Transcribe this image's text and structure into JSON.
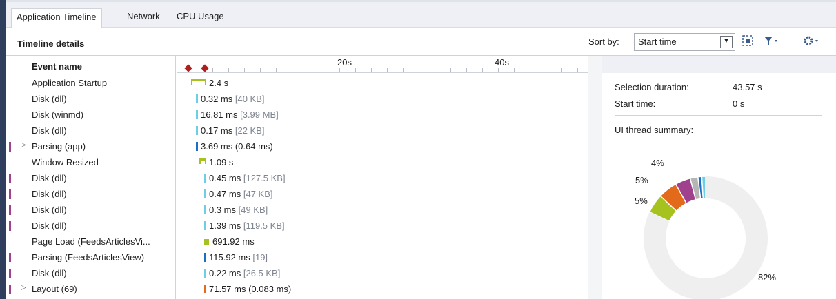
{
  "tabs": [
    {
      "label": "Application Timeline",
      "active": true
    },
    {
      "label": "Network",
      "active": false
    },
    {
      "label": "CPU Usage",
      "active": false
    }
  ],
  "header": {
    "title": "Timeline details",
    "sort_label": "Sort by:",
    "sort_value": "Start time",
    "icons": [
      "zoom-to-selection-icon",
      "filter-icon",
      "settings-icon"
    ]
  },
  "events": {
    "column_header": "Event name",
    "rows": [
      {
        "label": "Application Startup",
        "marker": false,
        "expandable": false
      },
      {
        "label": "Disk (dll)",
        "marker": false,
        "expandable": false
      },
      {
        "label": "Disk (winmd)",
        "marker": false,
        "expandable": false
      },
      {
        "label": "Disk (dll)",
        "marker": false,
        "expandable": false
      },
      {
        "label": "Parsing (app)",
        "marker": true,
        "expandable": true
      },
      {
        "label": "Window Resized",
        "marker": false,
        "expandable": false
      },
      {
        "label": "Disk (dll)",
        "marker": true,
        "expandable": false
      },
      {
        "label": "Disk (dll)",
        "marker": true,
        "expandable": false
      },
      {
        "label": "Disk (dll)",
        "marker": true,
        "expandable": false
      },
      {
        "label": "Disk (dll)",
        "marker": true,
        "expandable": false
      },
      {
        "label": "Page Load (FeedsArticlesVi...",
        "marker": false,
        "expandable": false
      },
      {
        "label": "Parsing (FeedsArticlesView)",
        "marker": true,
        "expandable": false
      },
      {
        "label": "Disk (dll)",
        "marker": true,
        "expandable": false
      },
      {
        "label": "Layout (69)",
        "marker": true,
        "expandable": true
      }
    ]
  },
  "timeline": {
    "ruler_labels": [
      "20s",
      "40s"
    ],
    "bars": [
      {
        "kind": "bracket",
        "color": "#a6c21e",
        "text": "2.4 s",
        "extra": ""
      },
      {
        "kind": "solid",
        "color": "#6fcde4",
        "text": "0.32 ms",
        "extra": "[40 KB]"
      },
      {
        "kind": "solid",
        "color": "#6fcde4",
        "text": "16.81 ms",
        "extra": "[3.99 MB]"
      },
      {
        "kind": "solid",
        "color": "#6fcde4",
        "text": "0.17 ms",
        "extra": "[22 KB]"
      },
      {
        "kind": "solid",
        "color": "#1a6fc3",
        "text": "3.69 ms (0.64 ms)",
        "extra": ""
      },
      {
        "kind": "bracket",
        "color": "#a6c21e",
        "text": "1.09 s",
        "extra": ""
      },
      {
        "kind": "solid",
        "color": "#6fcde4",
        "text": "0.45 ms",
        "extra": "[127.5 KB]"
      },
      {
        "kind": "solid",
        "color": "#6fcde4",
        "text": "0.47 ms",
        "extra": "[47 KB]"
      },
      {
        "kind": "solid",
        "color": "#6fcde4",
        "text": "0.3 ms",
        "extra": "[49 KB]"
      },
      {
        "kind": "solid",
        "color": "#6fcde4",
        "text": "1.39 ms",
        "extra": "[119.5 KB]"
      },
      {
        "kind": "square",
        "color": "#a6c21e",
        "text": "691.92 ms",
        "extra": ""
      },
      {
        "kind": "solid",
        "color": "#1a6fc3",
        "text": "115.92 ms",
        "extra": "[19]"
      },
      {
        "kind": "solid",
        "color": "#6fcde4",
        "text": "0.22 ms",
        "extra": "[26.5 KB]"
      },
      {
        "kind": "solid",
        "color": "#e36a1a",
        "text": "71.57 ms (0.083 ms)",
        "extra": ""
      }
    ]
  },
  "summary": {
    "selection_duration_label": "Selection duration:",
    "selection_duration_value": "43.57 s",
    "start_time_label": "Start time:",
    "start_time_value": "0 s",
    "ui_thread_label": "UI thread summary:"
  },
  "chart_data": {
    "type": "pie",
    "style": "donut",
    "values_pct": [
      82,
      5,
      5,
      4,
      2,
      1,
      1
    ],
    "colors": [
      "#efefef",
      "#a6c21e",
      "#e36a1a",
      "#a0418e",
      "#b5b5b5",
      "#1a6fc3",
      "#6fcde4"
    ],
    "data_labels": [
      "82%",
      "5%",
      "5%",
      "4%"
    ]
  }
}
